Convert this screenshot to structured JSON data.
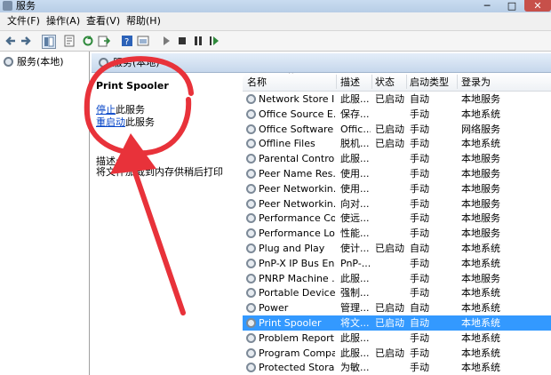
{
  "window": {
    "title": "服务",
    "min": "─",
    "max": "□",
    "close": "✕"
  },
  "menu": {
    "items": [
      "文件(F)",
      "操作(A)",
      "查看(V)",
      "帮助(H)"
    ]
  },
  "toolbar": {
    "icons": [
      "back-icon",
      "forward-icon",
      "show-tree-icon",
      "properties-icon",
      "refresh-icon",
      "export-icon",
      "help-icon",
      "view-icon",
      "play-icon",
      "stop-icon",
      "pause-icon",
      "restart-icon"
    ]
  },
  "tree": {
    "root_label": "服务(本地)"
  },
  "header": {
    "title": "服务(本地)"
  },
  "detail": {
    "service_name": "Print Spooler",
    "stop_link": "停止",
    "stop_suffix": "此服务",
    "restart_link": "重启动",
    "restart_suffix": "此服务",
    "desc_label": "描述:",
    "desc_text": "将文件加载到内存供稍后打印"
  },
  "columns": {
    "name": "名称",
    "desc": "描述",
    "status": "状态",
    "start": "启动类型",
    "logon": "登录为"
  },
  "rows": [
    {
      "name": "Network Store I...",
      "desc": "此服...",
      "status": "已启动",
      "start": "自动",
      "logon": "本地服务"
    },
    {
      "name": "Office  Source E...",
      "desc": "保存...",
      "status": "",
      "start": "手动",
      "logon": "本地系统"
    },
    {
      "name": "Office Software ...",
      "desc": "Offic...",
      "status": "已启动",
      "start": "手动",
      "logon": "网络服务"
    },
    {
      "name": "Offline Files",
      "desc": "脱机...",
      "status": "已启动",
      "start": "手动",
      "logon": "本地系统"
    },
    {
      "name": "Parental Controls",
      "desc": "此服...",
      "status": "",
      "start": "手动",
      "logon": "本地服务"
    },
    {
      "name": "Peer Name Res...",
      "desc": "使用...",
      "status": "",
      "start": "手动",
      "logon": "本地服务"
    },
    {
      "name": "Peer Networkin...",
      "desc": "使用...",
      "status": "",
      "start": "手动",
      "logon": "本地服务"
    },
    {
      "name": "Peer Networkin...",
      "desc": "向对...",
      "status": "",
      "start": "手动",
      "logon": "本地服务"
    },
    {
      "name": "Performance Co...",
      "desc": "使远...",
      "status": "",
      "start": "手动",
      "logon": "本地服务"
    },
    {
      "name": "Performance Lo...",
      "desc": "性能...",
      "status": "",
      "start": "手动",
      "logon": "本地服务"
    },
    {
      "name": "Plug and Play",
      "desc": "使计...",
      "status": "已启动",
      "start": "自动",
      "logon": "本地系统"
    },
    {
      "name": "PnP-X IP Bus En...",
      "desc": "PnP-...",
      "status": "",
      "start": "手动",
      "logon": "本地系统"
    },
    {
      "name": "PNRP Machine ...",
      "desc": "此服...",
      "status": "",
      "start": "手动",
      "logon": "本地服务"
    },
    {
      "name": "Portable Device ...",
      "desc": "强制...",
      "status": "",
      "start": "手动",
      "logon": "本地系统"
    },
    {
      "name": "Power",
      "desc": "管理...",
      "status": "已启动",
      "start": "自动",
      "logon": "本地系统"
    },
    {
      "name": "Print Spooler",
      "desc": "将文...",
      "status": "已启动",
      "start": "自动",
      "logon": "本地系统",
      "selected": true
    },
    {
      "name": "Problem Report...",
      "desc": "此服...",
      "status": "",
      "start": "手动",
      "logon": "本地系统"
    },
    {
      "name": "Program Compa...",
      "desc": "此服...",
      "status": "已启动",
      "start": "手动",
      "logon": "本地系统"
    },
    {
      "name": "Protected Storage",
      "desc": "为敏...",
      "status": "",
      "start": "手动",
      "logon": "本地系统"
    }
  ],
  "colors": {
    "selection": "#3399ff",
    "annotation": "#e8323a",
    "link": "#0645c8"
  }
}
